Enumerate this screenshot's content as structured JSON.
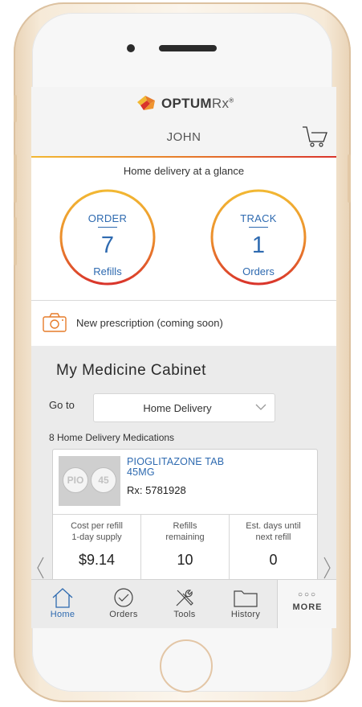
{
  "header": {
    "brand_name": "OPTUM",
    "brand_suffix": "Rx",
    "brand_mark": "®",
    "user_name": "JOHN"
  },
  "glance": {
    "title": "Home delivery at a glance",
    "order": {
      "label": "ORDER",
      "count": "7",
      "sublabel": "Refills"
    },
    "track": {
      "label": "TRACK",
      "count": "1",
      "sublabel": "Orders"
    }
  },
  "new_prescription": {
    "label": "New prescription (coming soon)"
  },
  "cabinet": {
    "title": "My Medicine Cabinet",
    "goto_label": "Go to",
    "goto_value": "Home Delivery",
    "count_text": "8 Home Delivery Medications",
    "medication": {
      "name_line1": "PIOGLITAZONE TAB",
      "name_line2": "45MG",
      "rx": "Rx: 5781928",
      "pill_text_left": "PIO",
      "pill_text_right": "45",
      "cost_label_1": "Cost per refill",
      "cost_label_2": "1-day supply",
      "cost_value": "$9.14",
      "refills_label_1": "Refills",
      "refills_label_2": "remaining",
      "refills_value": "10",
      "days_label_1": "Est. days until",
      "days_label_2": "next refill",
      "days_value": "0"
    }
  },
  "tabs": [
    {
      "label": "Home",
      "icon": "home-icon",
      "active": true
    },
    {
      "label": "Orders",
      "icon": "check-circle-icon"
    },
    {
      "label": "Tools",
      "icon": "tools-icon"
    },
    {
      "label": "History",
      "icon": "folder-icon"
    }
  ],
  "more": {
    "dots": "○○○",
    "label": "MORE"
  },
  "colors": {
    "accent_blue": "#2e6ab0",
    "ring_start": "#f2b833",
    "ring_end": "#d9342b",
    "brand_orange": "#e67c2a"
  }
}
